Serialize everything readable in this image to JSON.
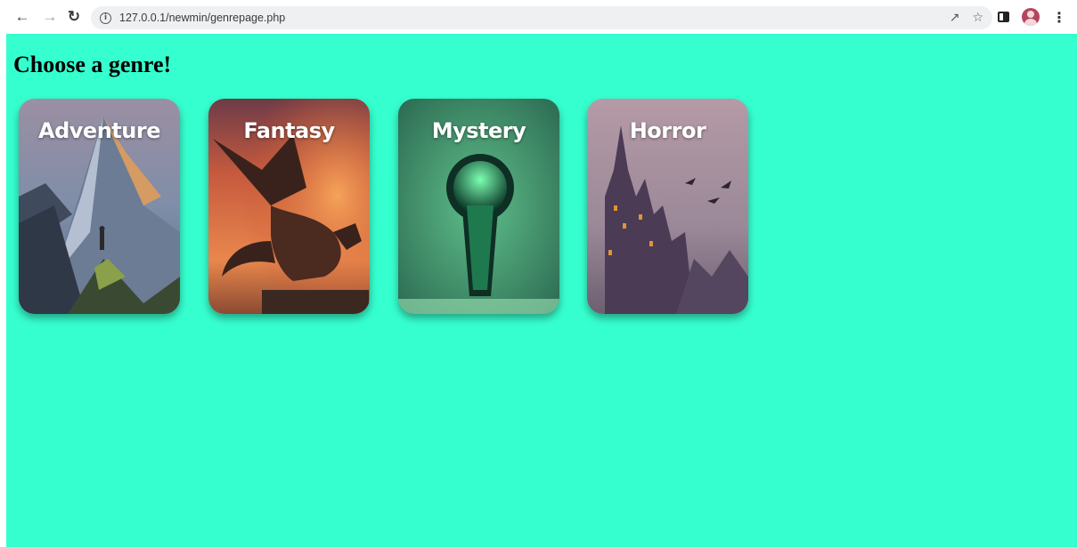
{
  "browser": {
    "url": "127.0.0.1/newmin/genrepage.php"
  },
  "page": {
    "title": "Choose a genre!"
  },
  "genres": [
    {
      "label": "Adventure"
    },
    {
      "label": "Fantasy"
    },
    {
      "label": "Mystery"
    },
    {
      "label": "Horror"
    }
  ],
  "colors": {
    "page_background": "#36ffcf"
  }
}
